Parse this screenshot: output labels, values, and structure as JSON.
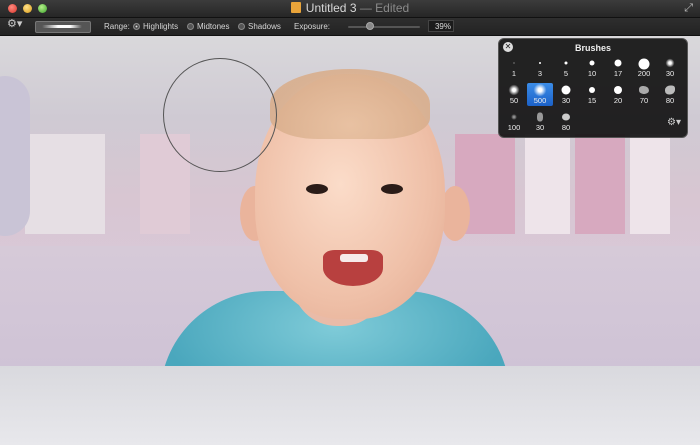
{
  "window": {
    "title": "Untitled 3",
    "status": "— Edited"
  },
  "toolbar": {
    "range_label": "Range:",
    "range_options": [
      "Highlights",
      "Midtones",
      "Shadows"
    ],
    "range_selected": "Highlights",
    "exposure_label": "Exposure:",
    "exposure_value": "39%"
  },
  "brushes_panel": {
    "title": "Brushes",
    "rows": [
      [
        "1",
        "3",
        "5",
        "10",
        "17",
        "200",
        "30"
      ],
      [
        "50",
        "500",
        "30",
        "15",
        "20",
        "70",
        "80"
      ],
      [
        "100",
        "30",
        "80"
      ]
    ],
    "selected": "500"
  },
  "icons": {
    "close": "close-icon",
    "gear": "gear-icon",
    "fullscreen": "fullscreen-icon",
    "document": "document-icon"
  }
}
